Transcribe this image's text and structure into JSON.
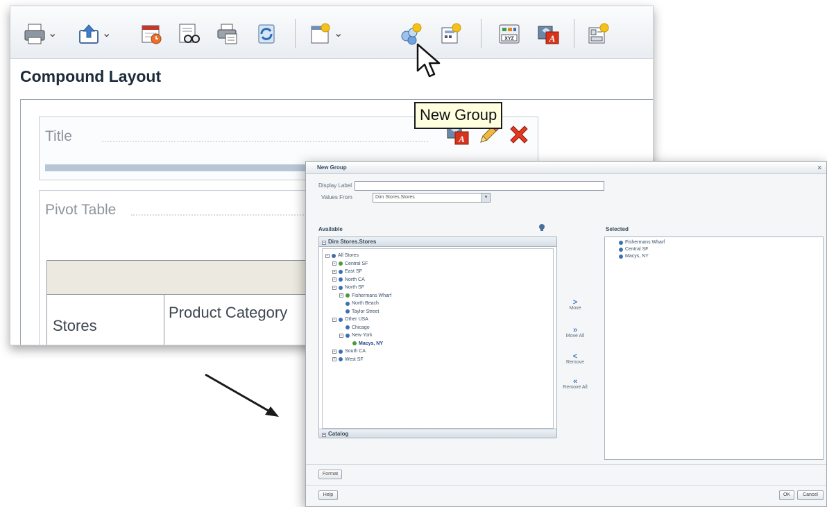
{
  "toolbar": {
    "icons": [
      "print-icon",
      "export-icon",
      "schedule-icon",
      "preview-icon",
      "copy-layout-icon",
      "refresh-icon",
      "insert-view-icon",
      "new-group-icon",
      "new-calculated-item-icon",
      "data-model-icon",
      "format-icon",
      "properties-icon"
    ]
  },
  "layout": {
    "title": "Compound Layout",
    "title_block_label": "Title",
    "pivot_block_label": "Pivot Table",
    "columns": [
      "Stores",
      "Product Category"
    ]
  },
  "tooltip": {
    "text": "New Group"
  },
  "dialog": {
    "title": "New Group",
    "display_label_label": "Display Label",
    "display_label_value": "",
    "values_from_label": "Values From",
    "values_from_value": "Dim Stores.Stores",
    "available_label": "Available",
    "selected_label": "Selected",
    "available_panel_title": "Dim Stores.Stores",
    "catalog_label": "Catalog",
    "tree": [
      {
        "label": "All Stores",
        "level": 0,
        "toggle": "−",
        "kind": "node"
      },
      {
        "label": "Central SF",
        "level": 1,
        "toggle": "+",
        "kind": "group"
      },
      {
        "label": "East SF",
        "level": 1,
        "toggle": "+",
        "kind": "node"
      },
      {
        "label": "North CA",
        "level": 1,
        "toggle": "+",
        "kind": "node"
      },
      {
        "label": "North SF",
        "level": 1,
        "toggle": "−",
        "kind": "node"
      },
      {
        "label": "Fishermans Wharf",
        "level": 2,
        "toggle": "+",
        "kind": "group"
      },
      {
        "label": "North Beach",
        "level": 2,
        "toggle": "",
        "kind": "node"
      },
      {
        "label": "Taylor Street",
        "level": 2,
        "toggle": "",
        "kind": "node"
      },
      {
        "label": "Other USA",
        "level": 1,
        "toggle": "−",
        "kind": "node"
      },
      {
        "label": "Chicago",
        "level": 2,
        "toggle": "",
        "kind": "node"
      },
      {
        "label": "New York",
        "level": 2,
        "toggle": "−",
        "kind": "node"
      },
      {
        "label": "Macys, NY",
        "level": 3,
        "toggle": "",
        "kind": "group",
        "selected": true
      },
      {
        "label": "South CA",
        "level": 1,
        "toggle": "+",
        "kind": "node"
      },
      {
        "label": "West SF",
        "level": 1,
        "toggle": "+",
        "kind": "node"
      }
    ],
    "shuttle": [
      {
        "glyph": ">",
        "label": "Move"
      },
      {
        "glyph": "»",
        "label": "Move All"
      },
      {
        "glyph": "<",
        "label": "Remove"
      },
      {
        "glyph": "«",
        "label": "Remove All"
      }
    ],
    "selected_items": [
      "Fishermans Wharf",
      "Central SF",
      "Macys, NY"
    ],
    "format_button": "Format",
    "help_button": "Help",
    "ok_button": "OK",
    "cancel_button": "Cancel"
  }
}
